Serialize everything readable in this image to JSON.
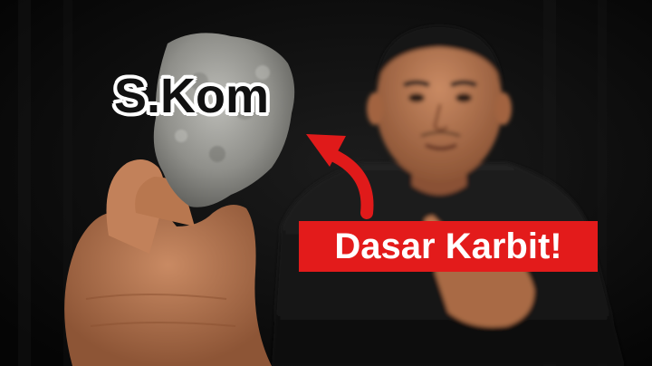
{
  "overlay": {
    "top_caption": "S.Kom",
    "banner_caption": "Dasar Karbit!"
  },
  "colors": {
    "background": "#0c0c0c",
    "banner_red": "#e31b1b",
    "arrow_red": "#e01a1a",
    "caption_text": "#111111",
    "caption_outline": "#ffffff",
    "banner_text": "#ffffff"
  },
  "icons": {
    "arrow": "curved-arrow-icon"
  }
}
